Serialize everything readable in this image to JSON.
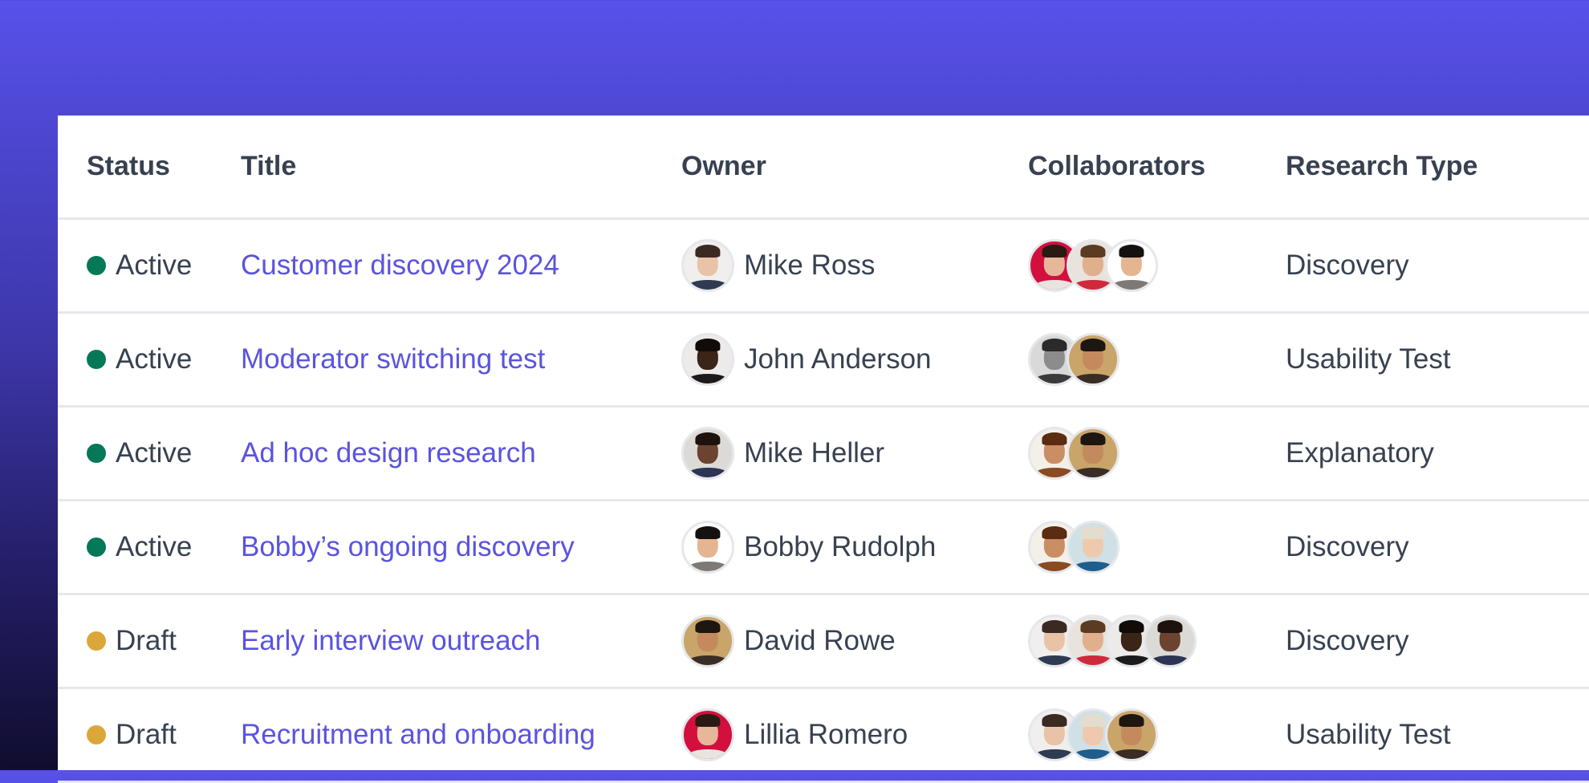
{
  "colors": {
    "accent": "#5a53e0",
    "text": "#374151",
    "divider": "#e5e7eb",
    "status_active": "#047857",
    "status_draft": "#dba73b"
  },
  "table": {
    "headers": {
      "status": "Status",
      "title": "Title",
      "owner": "Owner",
      "collaborators": "Collaborators",
      "research_type": "Research Type"
    },
    "rows": [
      {
        "status": "Active",
        "status_color": "#047857",
        "title": "Customer discovery 2024",
        "owner": {
          "name": "Mike Ross",
          "avatar": {
            "bg": "#f1efed",
            "skin": "#e9c3a8",
            "hair": "#3a2a22",
            "shirt": "#2f3b52"
          }
        },
        "collaborators": [
          {
            "avatar": {
              "bg": "#d3103d",
              "skin": "#e6b79a",
              "hair": "#2a1a14",
              "shirt": "#e9e4df"
            }
          },
          {
            "avatar": {
              "bg": "#e8e3dc",
              "skin": "#e0b08e",
              "hair": "#5b3c22",
              "shirt": "#cf2a3c"
            }
          },
          {
            "avatar": {
              "bg": "#ffffff",
              "skin": "#e5b592",
              "hair": "#151110",
              "shirt": "#7d7a76"
            }
          }
        ],
        "research_type": "Discovery"
      },
      {
        "status": "Active",
        "status_color": "#047857",
        "title": "Moderator switching test",
        "owner": {
          "name": "John Anderson",
          "avatar": {
            "bg": "#ecebea",
            "skin": "#3b2418",
            "hair": "#120c09",
            "shirt": "#1c1a1a"
          }
        },
        "collaborators": [
          {
            "avatar": {
              "bg": "#d9d9d9",
              "skin": "#8c8c8c",
              "hair": "#2b2b2b",
              "shirt": "#3a3a3a"
            }
          },
          {
            "avatar": {
              "bg": "#c9a56a",
              "skin": "#c48a5e",
              "hair": "#1e1611",
              "shirt": "#3a2d25"
            }
          }
        ],
        "research_type": "Usability Test"
      },
      {
        "status": "Active",
        "status_color": "#047857",
        "title": "Ad hoc design research",
        "owner": {
          "name": "Mike Heller",
          "avatar": {
            "bg": "#dcdad7",
            "skin": "#6b4330",
            "hair": "#1d120d",
            "shirt": "#2c3553"
          }
        },
        "collaborators": [
          {
            "avatar": {
              "bg": "#f5efe9",
              "skin": "#c98e63",
              "hair": "#5a2c12",
              "shirt": "#8a4a22"
            }
          },
          {
            "avatar": {
              "bg": "#c9a56a",
              "skin": "#c48a5e",
              "hair": "#1e1611",
              "shirt": "#3a2d25"
            }
          }
        ],
        "research_type": "Explanatory"
      },
      {
        "status": "Active",
        "status_color": "#047857",
        "title": "Bobby’s ongoing discovery",
        "owner": {
          "name": "Bobby Rudolph",
          "avatar": {
            "bg": "#ffffff",
            "skin": "#e5b592",
            "hair": "#151110",
            "shirt": "#7d7a76"
          }
        },
        "collaborators": [
          {
            "avatar": {
              "bg": "#f5efe9",
              "skin": "#c98e63",
              "hair": "#5a2c12",
              "shirt": "#8a4a22"
            }
          },
          {
            "avatar": {
              "bg": "#cfe0e6",
              "skin": "#efc9ad",
              "hair": "#e4dccd",
              "shirt": "#1f5d8c"
            }
          }
        ],
        "research_type": "Discovery"
      },
      {
        "status": "Draft",
        "status_color": "#dba73b",
        "title": "Early interview outreach",
        "owner": {
          "name": "David Rowe",
          "avatar": {
            "bg": "#c9a56a",
            "skin": "#c48a5e",
            "hair": "#1e1611",
            "shirt": "#3a2d25"
          }
        },
        "collaborators": [
          {
            "avatar": {
              "bg": "#f1efed",
              "skin": "#e9c3a8",
              "hair": "#3a2a22",
              "shirt": "#2f3b52"
            }
          },
          {
            "avatar": {
              "bg": "#e8e3dc",
              "skin": "#e0b08e",
              "hair": "#5b3c22",
              "shirt": "#cf2a3c"
            }
          },
          {
            "avatar": {
              "bg": "#ecebea",
              "skin": "#3b2418",
              "hair": "#120c09",
              "shirt": "#1c1a1a"
            }
          },
          {
            "avatar": {
              "bg": "#dcdad7",
              "skin": "#6b4330",
              "hair": "#1d120d",
              "shirt": "#2c3553"
            }
          }
        ],
        "research_type": "Discovery"
      },
      {
        "status": "Draft",
        "status_color": "#dba73b",
        "title": "Recruitment and onboarding",
        "owner": {
          "name": "Lillia Romero",
          "avatar": {
            "bg": "#d3103d",
            "skin": "#e6b79a",
            "hair": "#2a1a14",
            "shirt": "#e9e4df"
          }
        },
        "collaborators": [
          {
            "avatar": {
              "bg": "#f1efed",
              "skin": "#e9c3a8",
              "hair": "#3a2a22",
              "shirt": "#2f3b52"
            }
          },
          {
            "avatar": {
              "bg": "#cfe0e6",
              "skin": "#efc9ad",
              "hair": "#e4dccd",
              "shirt": "#1f5d8c"
            }
          },
          {
            "avatar": {
              "bg": "#c9a56a",
              "skin": "#c48a5e",
              "hair": "#1e1611",
              "shirt": "#3a2d25"
            }
          }
        ],
        "research_type": "Usability Test"
      }
    ]
  }
}
